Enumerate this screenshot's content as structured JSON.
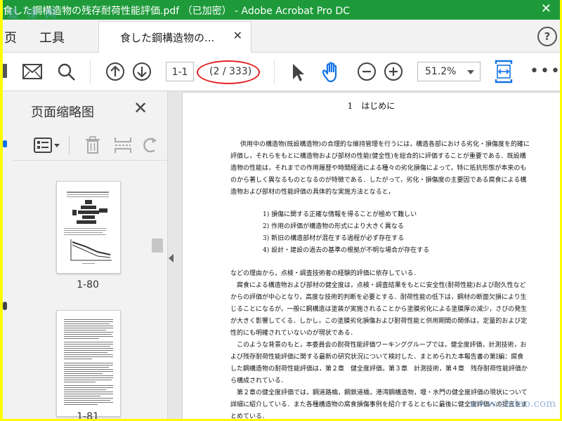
{
  "window": {
    "title": "食した鋼構造物の残存耐荷性能評価.pdf （已加密） - Adobe Acrobat Pro DC",
    "watermark": "道  禄 网"
  },
  "menu": {
    "items": [
      "页",
      "工具"
    ],
    "tab_label": "食した鋼構造物の...",
    "help_icon": "?"
  },
  "toolbar": {
    "page_input": "1-1",
    "page_count": "(2 / 333)",
    "zoom": "51.2%"
  },
  "panel": {
    "title": "页面缩略图",
    "thumbnails": [
      {
        "label": "1-80"
      },
      {
        "label": "1-81"
      }
    ]
  },
  "document": {
    "heading": "1　はじめに",
    "lines": [
      "供用中の構造物(既設構造物)の合理的な維持管理を行うには，構造各部における劣化・損傷度を的確に",
      "評価し，それらをもとに構造物および部材の性能(健全性)を総合的に評価することが重要である．既設構",
      "造物の性能は，それまでの作用履歴や時間経過による種々の劣化損傷によって，特に抵抗形態が本来のも",
      "のから著しく異なるものとなるのが特徴である．したがって，劣化・損傷度の主要因である腐食による構",
      "造物および部材の性能評価の具体的な実施方法となると，"
    ],
    "list": [
      "1)  損傷に関する正確な情報を得ることが極めて難しい",
      "2)  作用の評価が構造物の形式により大きく異なる",
      "3)  新旧の構造部材が混在する過程が必ず存在する",
      "4)  設計・建設の過去の基準の根拠が不明な場合が存在する"
    ],
    "lines2": [
      "などの理由から，点検・調査技術者の経験的評価に依存している．",
      "　腐食による構造物および部材の健全度は，点検・調査結果をもとに安全性(耐荷性能)および耐久性など",
      "からの評価が中心となり，高度な技術的判断を必要とする．耐荷性能の低下は，鋼材の断面欠損により生",
      "じることになるが，一般に鋼構造は塗装が実施されることから塗膜劣化による塗膜厚の減少，さびの発生",
      "が大きく影響してくる．しかし，この塗膜劣化損傷および耐荷性能と供用期間の関係は，定量的および定",
      "性的にも明確されていないのが現状である．",
      "　このような背景のもと，本委員会の耐荷性能評価ワーキンググループでは，健全度評価，計測技術，お",
      "よび残存耐荷性能評価に関する最新の研究状況について検討した．まとめられた本報告書の第Ⅰ編：腐食",
      "した鋼構造物の耐荷性能評価は，第２章　健全度評価，第３章　計測技術，第４章　残存耐荷性能評価か",
      "ら構成されている．",
      "　第２章の健全度評価では，鋼道路橋，鋼鉄道橋，港湾鋼構造物，堰・水門の健全度評価の現状について",
      "詳細に紹介している．また各種構造物の腐食損傷事例を紹介するとともに最後に健全度評価への提言をま",
      "とめている．"
    ]
  },
  "overlay": {
    "site_watermark": "www.chdao.com"
  },
  "colors": {
    "titlebar": "#1e9a3a",
    "accent": "#1473e6",
    "highlight_ellipse": "#e32020"
  }
}
